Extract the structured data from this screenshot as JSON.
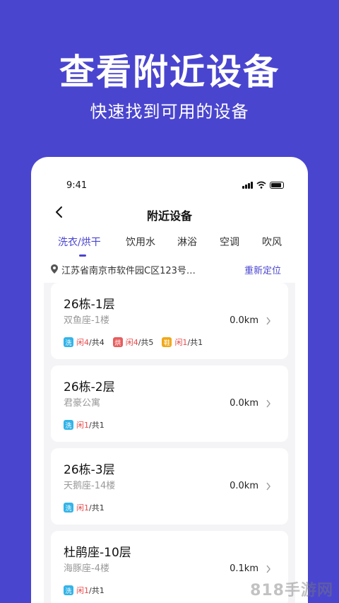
{
  "hero": {
    "title": "查看附近设备",
    "subtitle": "快速找到可用的设备"
  },
  "status": {
    "time": "9:41"
  },
  "nav": {
    "title": "附近设备"
  },
  "tabs": [
    {
      "label": "洗衣/烘干"
    },
    {
      "label": "饮用水"
    },
    {
      "label": "淋浴"
    },
    {
      "label": "空调"
    },
    {
      "label": "吹风"
    }
  ],
  "location": {
    "address": "江苏省南京市软件园C区123号…",
    "relocate": "重新定位"
  },
  "cards": [
    {
      "name": "26栋-1层",
      "addr": "双鱼座-1楼",
      "dist": "0.0km",
      "badges": [
        {
          "icon": "洗",
          "color": "#33b4e8",
          "free": "闲4",
          "total": "/共4"
        },
        {
          "icon": "烘",
          "color": "#e85d5d",
          "free": "闲4",
          "total": "/共5"
        },
        {
          "icon": "鞋",
          "color": "#f0a818",
          "free": "闲1",
          "total": "/共1"
        }
      ]
    },
    {
      "name": "26栋-2层",
      "addr": "君豪公寓",
      "dist": "0.0km",
      "badges": [
        {
          "icon": "洗",
          "color": "#33b4e8",
          "free": "闲1",
          "total": "/共1"
        }
      ]
    },
    {
      "name": "26栋-3层",
      "addr": "天鹅座-14楼",
      "dist": "0.0km",
      "badges": [
        {
          "icon": "洗",
          "color": "#33b4e8",
          "free": "闲1",
          "total": "/共1"
        }
      ]
    },
    {
      "name": "杜鹃座-10层",
      "addr": "海豚座-4楼",
      "dist": "0.1km",
      "badges": [
        {
          "icon": "洗",
          "color": "#33b4e8",
          "free": "闲1",
          "total": "/共1"
        }
      ]
    }
  ],
  "watermark": "818手游网",
  "colors": {
    "brand": "#4a45cf",
    "free": "#e64b4b"
  }
}
